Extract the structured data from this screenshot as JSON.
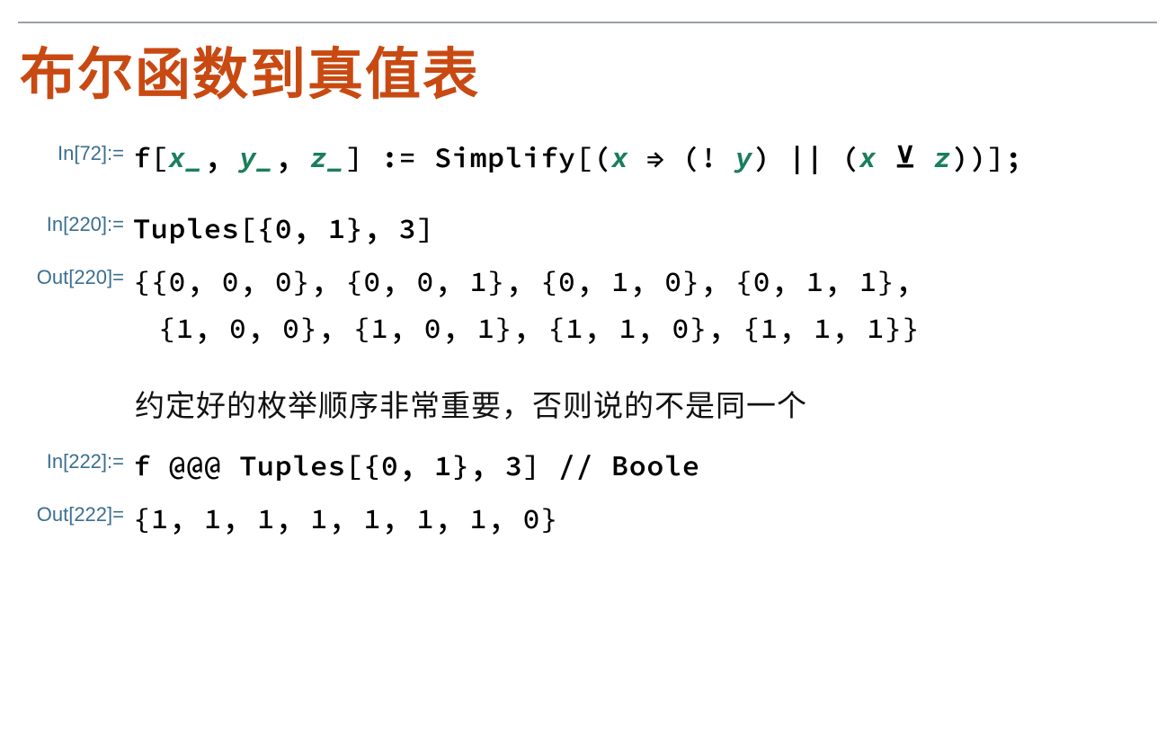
{
  "section": {
    "title": "布尔函数到真值表"
  },
  "cells": {
    "in72": {
      "label": "In[72]:=",
      "code_prefix": "f[",
      "x": "x_",
      "c1": ", ",
      "y": "y_",
      "c2": ", ",
      "z": "z_",
      "code_mid": "] := Simplify[(",
      "xv": "x",
      "arrow": " ⇒ (! ",
      "yv": "y",
      "close1": ") || (",
      "xv2": "x",
      "xor": " ⊻ ",
      "zv": "z",
      "close2": "))];"
    },
    "in220": {
      "label": "In[220]:=",
      "code": "Tuples[{0, 1}, 3]"
    },
    "out220": {
      "label": "Out[220]=",
      "line1": "{{0, 0, 0}, {0, 0, 1}, {0, 1, 0}, {0, 1, 1},",
      "line2": " {1, 0, 0}, {1, 0, 1}, {1, 1, 0}, {1, 1, 1}}"
    },
    "text1": "约定好的枚举顺序非常重要，否则说的不是同一个",
    "in222": {
      "label": "In[222]:=",
      "code": "f @@@ Tuples[{0, 1}, 3] // Boole"
    },
    "out222": {
      "label": "Out[222]=",
      "code": "{1, 1, 1, 1, 1, 1, 1, 0}"
    }
  }
}
